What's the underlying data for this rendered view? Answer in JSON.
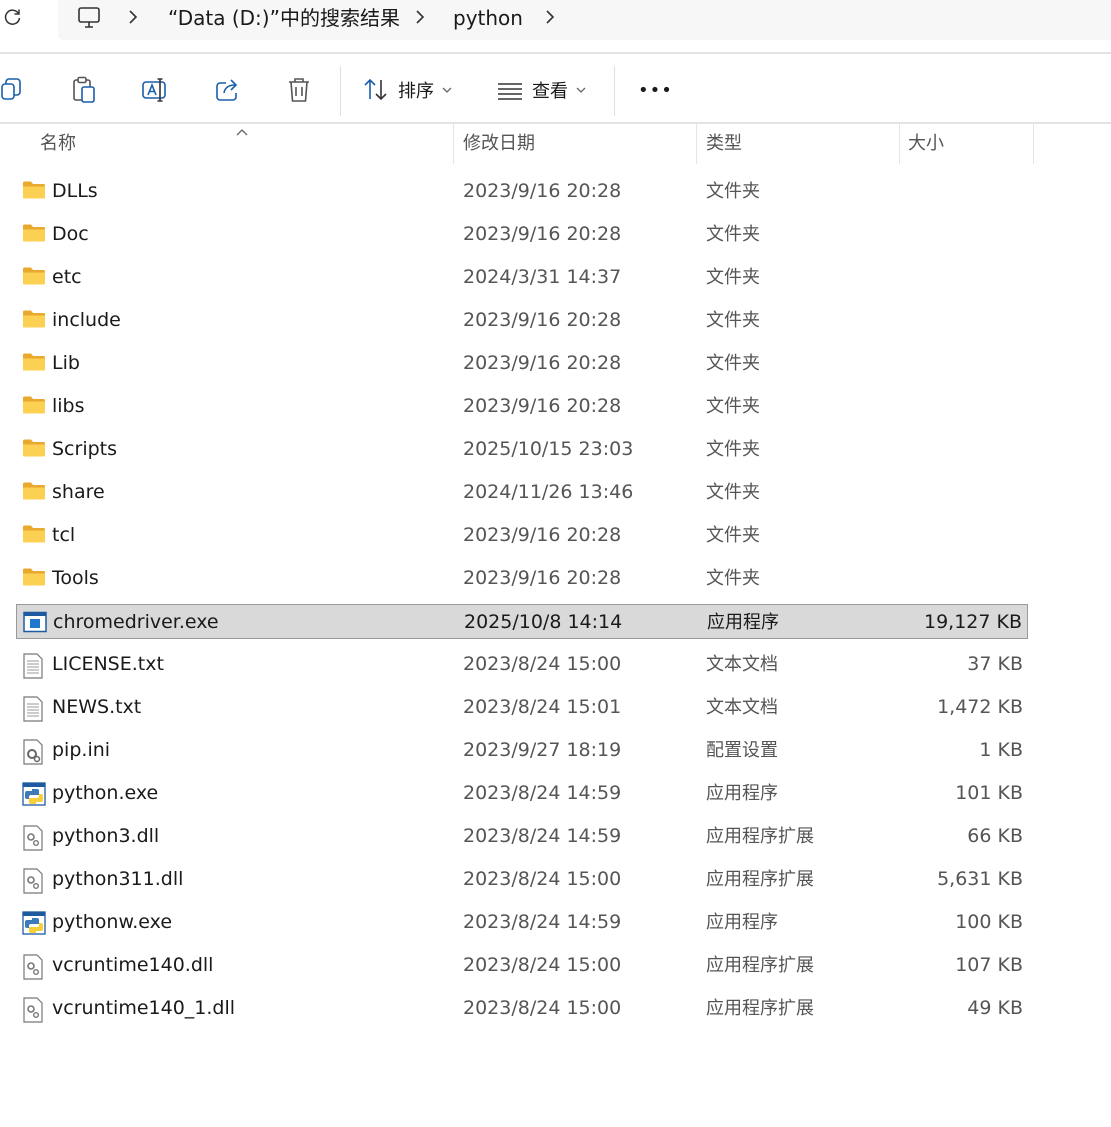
{
  "address": {
    "icon": "refresh-icon",
    "crumbs": [
      {
        "icon": "this-pc-icon"
      },
      {
        "label": "“Data (D:)”中的搜索结果"
      },
      {
        "label": "python"
      }
    ]
  },
  "toolbar": {
    "icons": [
      "copy-icon",
      "paste-icon",
      "rename-icon",
      "share-icon",
      "delete-icon"
    ],
    "sort_label": "排序",
    "view_label": "查看",
    "more_label": "•••"
  },
  "columns": {
    "name": "名称",
    "modified": "修改日期",
    "type": "类型",
    "size": "大小"
  },
  "accent": "#0f6cbd",
  "folder_color": "#f5c344",
  "files": [
    {
      "name": "DLLs",
      "date": "2023/9/16 20:28",
      "type": "文件夹",
      "size": "",
      "icon": "folder-icon"
    },
    {
      "name": "Doc",
      "date": "2023/9/16 20:28",
      "type": "文件夹",
      "size": "",
      "icon": "folder-icon"
    },
    {
      "name": "etc",
      "date": "2024/3/31 14:37",
      "type": "文件夹",
      "size": "",
      "icon": "folder-icon"
    },
    {
      "name": "include",
      "date": "2023/9/16 20:28",
      "type": "文件夹",
      "size": "",
      "icon": "folder-icon"
    },
    {
      "name": "Lib",
      "date": "2023/9/16 20:28",
      "type": "文件夹",
      "size": "",
      "icon": "folder-icon"
    },
    {
      "name": "libs",
      "date": "2023/9/16 20:28",
      "type": "文件夹",
      "size": "",
      "icon": "folder-icon"
    },
    {
      "name": "Scripts",
      "date": "2025/10/15 23:03",
      "type": "文件夹",
      "size": "",
      "icon": "folder-icon"
    },
    {
      "name": "share",
      "date": "2024/11/26 13:46",
      "type": "文件夹",
      "size": "",
      "icon": "folder-icon"
    },
    {
      "name": "tcl",
      "date": "2023/9/16 20:28",
      "type": "文件夹",
      "size": "",
      "icon": "folder-icon"
    },
    {
      "name": "Tools",
      "date": "2023/9/16 20:28",
      "type": "文件夹",
      "size": "",
      "icon": "folder-icon"
    },
    {
      "name": "chromedriver.exe",
      "date": "2025/10/8 14:14",
      "type": "应用程序",
      "size": "19,127 KB",
      "icon": "exe-icon",
      "selected": true
    },
    {
      "name": "LICENSE.txt",
      "date": "2023/8/24 15:00",
      "type": "文本文档",
      "size": "37 KB",
      "icon": "text-file-icon"
    },
    {
      "name": "NEWS.txt",
      "date": "2023/8/24 15:01",
      "type": "文本文档",
      "size": "1,472 KB",
      "icon": "text-file-icon"
    },
    {
      "name": "pip.ini",
      "date": "2023/9/27 18:19",
      "type": "配置设置",
      "size": "1 KB",
      "icon": "config-file-icon"
    },
    {
      "name": "python.exe",
      "date": "2023/8/24 14:59",
      "type": "应用程序",
      "size": "101 KB",
      "icon": "python-exe-icon"
    },
    {
      "name": "python3.dll",
      "date": "2023/8/24 14:59",
      "type": "应用程序扩展",
      "size": "66 KB",
      "icon": "dll-file-icon"
    },
    {
      "name": "python311.dll",
      "date": "2023/8/24 15:00",
      "type": "应用程序扩展",
      "size": "5,631 KB",
      "icon": "dll-file-icon"
    },
    {
      "name": "pythonw.exe",
      "date": "2023/8/24 14:59",
      "type": "应用程序",
      "size": "100 KB",
      "icon": "python-exe-icon"
    },
    {
      "name": "vcruntime140.dll",
      "date": "2023/8/24 15:00",
      "type": "应用程序扩展",
      "size": "107 KB",
      "icon": "dll-file-icon"
    },
    {
      "name": "vcruntime140_1.dll",
      "date": "2023/8/24 15:00",
      "type": "应用程序扩展",
      "size": "49 KB",
      "icon": "dll-file-icon"
    }
  ]
}
